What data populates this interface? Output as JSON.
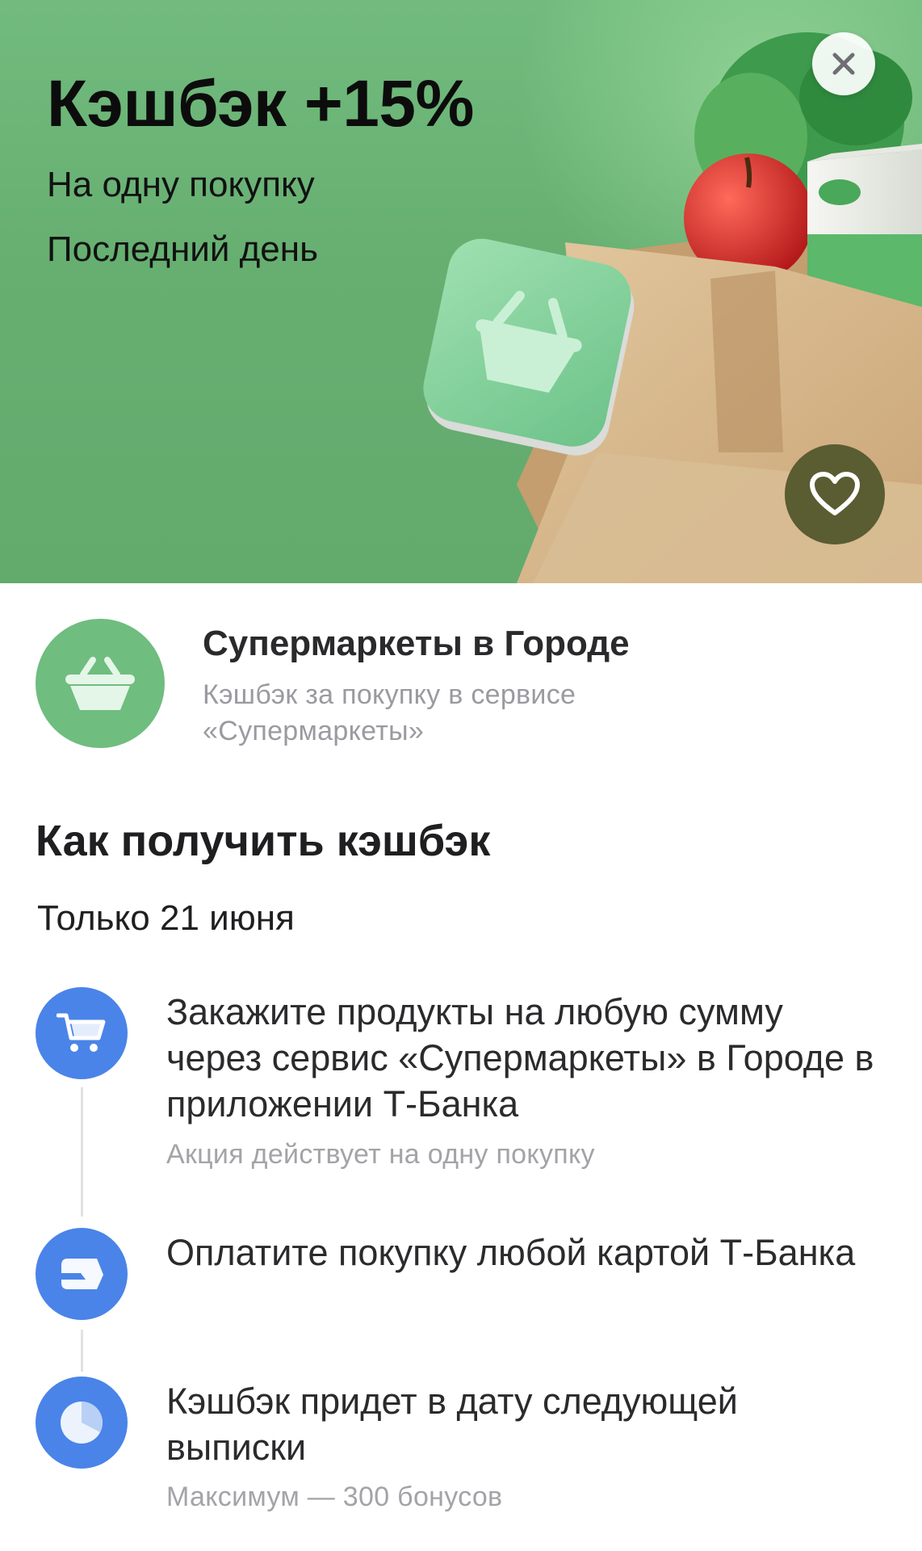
{
  "banner": {
    "title": "Кэшбэк +15%",
    "subtitle_1": "На одну покупку",
    "subtitle_2": "Последний день",
    "close_icon": "close-icon",
    "favorite_icon": "heart-icon"
  },
  "merchant": {
    "name": "Супермаркеты в Городе",
    "description": "Кэшбэк за покупку в сервисе «Супермаркеты»",
    "logo_icon": "basket-icon"
  },
  "how_to": {
    "title": "Как получить кэшбэк",
    "date": "Только 21 июня",
    "steps": [
      {
        "icon": "cart-icon",
        "text": "Закажите продукты на любую сумму через сервис «Супермаркеты» в Городе в приложении Т-Банка",
        "note": "Акция действует на одну покупку"
      },
      {
        "icon": "card-icon",
        "text": "Оплатите покупку любой картой Т-Банка",
        "note": ""
      },
      {
        "icon": "clock-icon",
        "text": "Кэшбэк придет в дату следующей выписки",
        "note": "Максимум — 300 бонусов"
      }
    ]
  },
  "colors": {
    "banner_green": "#66af71",
    "accent_blue": "#4a84e8",
    "merchant_green": "#6fbd7f",
    "like_button": "#5a5c32"
  }
}
